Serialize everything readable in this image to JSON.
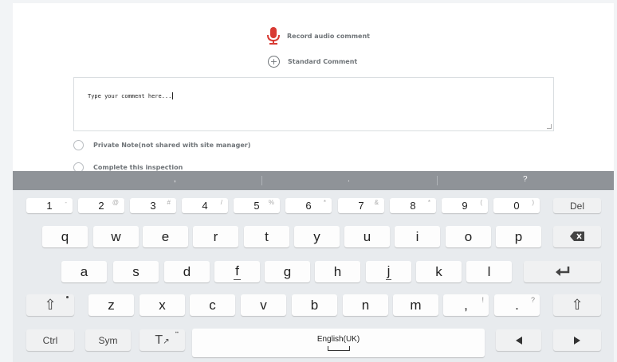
{
  "actions": {
    "record_audio": "Record audio comment",
    "standard_comment": "Standard Comment"
  },
  "comment": {
    "placeholder": "Type your comment here..."
  },
  "options": {
    "private_note": "Private Note(not shared with site manager)",
    "complete_inspection": "Complete this inspection"
  },
  "keyboard": {
    "suggestions": [
      ",",
      ".",
      "?"
    ],
    "number_row": [
      {
        "main": "1",
        "alt": "-"
      },
      {
        "main": "2",
        "alt": "@"
      },
      {
        "main": "3",
        "alt": "#"
      },
      {
        "main": "4",
        "alt": "/"
      },
      {
        "main": "5",
        "alt": "%"
      },
      {
        "main": "6",
        "alt": "*"
      },
      {
        "main": "7",
        "alt": "&"
      },
      {
        "main": "8",
        "alt": "*"
      },
      {
        "main": "9",
        "alt": "("
      },
      {
        "main": "0",
        "alt": ")"
      }
    ],
    "del": "Del",
    "row1": [
      "q",
      "w",
      "e",
      "r",
      "t",
      "y",
      "u",
      "i",
      "o",
      "p"
    ],
    "row2": [
      "a",
      "s",
      "d",
      "f",
      "g",
      "h",
      "j",
      "k",
      "l"
    ],
    "row3": [
      "z",
      "x",
      "c",
      "v",
      "b",
      "n",
      "m"
    ],
    "comma_key": {
      "main": ",",
      "alt": "!"
    },
    "period_key": {
      "main": ".",
      "alt": "?"
    },
    "ctrl": "Ctrl",
    "sym": "Sym",
    "language": "English(UK)",
    "colors": {
      "mic": "#d83b34",
      "suggestion_bar": "#8f9398"
    }
  }
}
